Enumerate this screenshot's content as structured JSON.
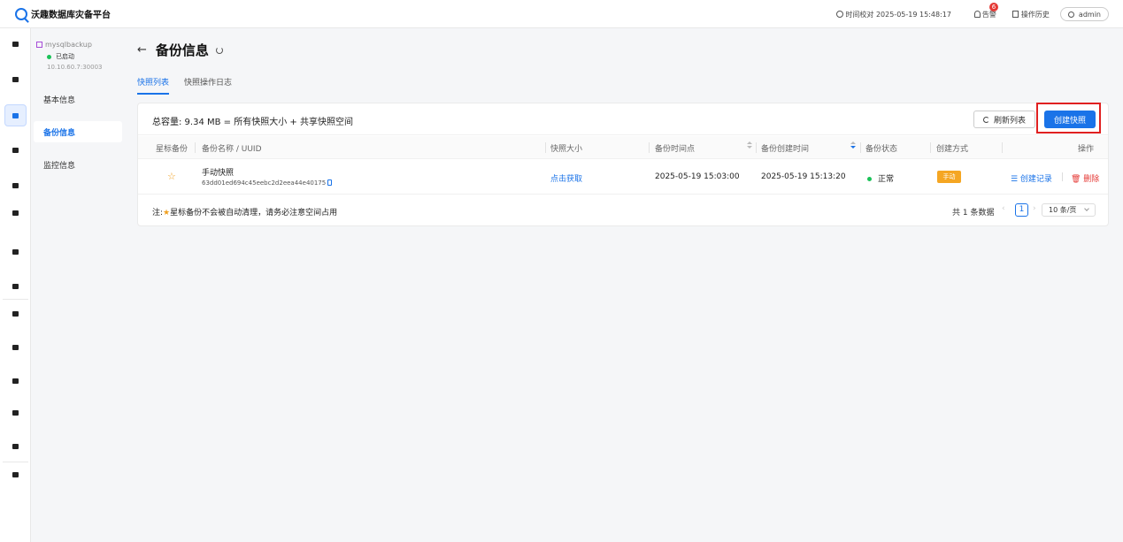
{
  "app": {
    "title": "沃趣数据库灾备平台"
  },
  "topbar": {
    "time_check": "时间校对 2025-05-19 15:48:17",
    "alarm_label": "告警",
    "alarm_count": "6",
    "history_label": "操作历史",
    "user": "admin"
  },
  "instance": {
    "name": "mysqlbackup",
    "status": "已启动",
    "address": "10.10.60.7:30003"
  },
  "side_menu": {
    "basic": "基本信息",
    "backup": "备份信息",
    "monitor": "监控信息"
  },
  "page": {
    "back": "←",
    "title": "备份信息"
  },
  "tabs": [
    "快照列表",
    "快照操作日志"
  ],
  "card": {
    "capacity": "总容量: 9.34 MB = 所有快照大小 + 共享快照空间",
    "refresh_label": "刷新列表",
    "create_label": "创建快照"
  },
  "table": {
    "columns": {
      "star": "星标备份",
      "name": "备份名称 / UUID",
      "size": "快照大小",
      "point": "备份时间点",
      "created": "备份创建时间",
      "status": "备份状态",
      "method": "创建方式",
      "ops": "操作"
    },
    "rows": [
      {
        "star": "☆",
        "name": "手动快照",
        "uuid": "63dd01ed694c45eebc2d2eea44e40175",
        "size": "点击获取",
        "point": "2025-05-19 15:03:00",
        "created": "2025-05-19 15:13:20",
        "status": "正常",
        "method": "手动",
        "op_create": "☰ 创建记录",
        "op_delete": "🗑 删除"
      }
    ]
  },
  "footer": {
    "note_prefix": "注:",
    "note_star": "★",
    "note_text": "星标备份不会被自动清理，请务必注意空间占用",
    "total": "共 1 条数据",
    "prev": "‹",
    "page": "1",
    "next": "›",
    "page_size": "10 条/页"
  },
  "colors": {
    "accent": "#1a73e8",
    "danger": "#e53935",
    "success": "#1ac258",
    "warning": "#f5a623"
  }
}
